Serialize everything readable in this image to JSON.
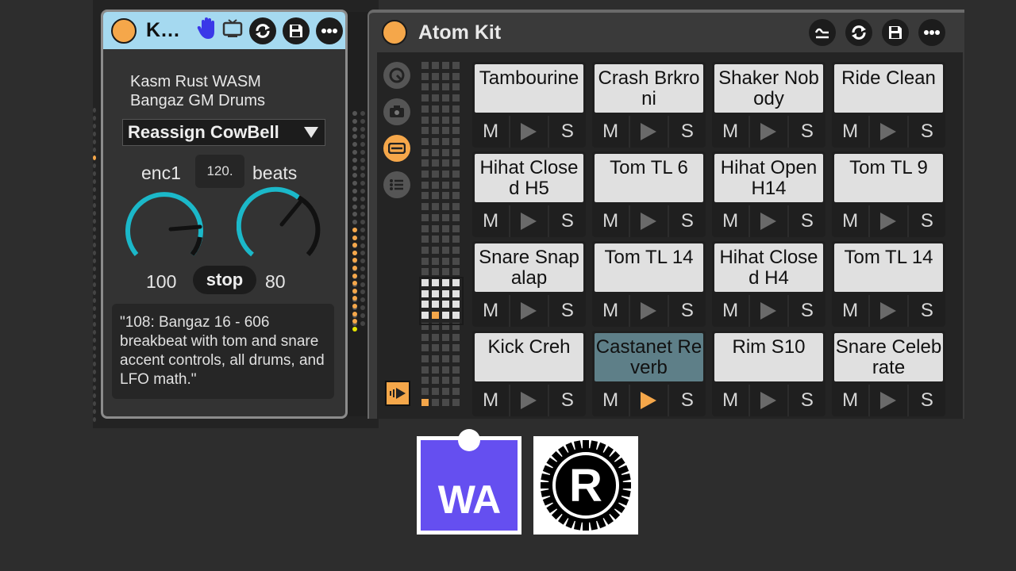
{
  "left_device": {
    "title": "K…",
    "lines": [
      "Kasm Rust WASM",
      "Bangaz GM Drums"
    ],
    "preset_select": "Reassign CowBell",
    "knob_left_label": "enc1",
    "tempo": "120.",
    "knob_right_label": "beats",
    "knob_left_value": "100",
    "knob_right_value": "80",
    "stop_label": "stop",
    "description": "\"108: Bangaz 16 - 606 breakbeat with tom and snare accent controls, all drums, and LFO math.\"",
    "icons": [
      "hand-icon",
      "tv-icon",
      "refresh-icon",
      "save-icon",
      "more-icon"
    ],
    "accent_color": "#a5d9f0",
    "knob_color": "#1bb8c9"
  },
  "right_device": {
    "title": "Atom Kit",
    "icons": [
      "wave-icon",
      "refresh-icon",
      "save-icon",
      "more-icon"
    ],
    "side_icons": [
      "circle-icon",
      "camera-icon",
      "pad-view-icon",
      "list-icon"
    ],
    "mute_label": "M",
    "solo_label": "S",
    "pads": [
      {
        "label": "Tambourine",
        "active": false,
        "playing": false
      },
      {
        "label": "Crash Brkroni",
        "active": false,
        "playing": false
      },
      {
        "label": "Shaker Nobody",
        "active": false,
        "playing": false
      },
      {
        "label": "Ride Clean",
        "active": false,
        "playing": false
      },
      {
        "label": "Hihat Closed H5",
        "active": false,
        "playing": false
      },
      {
        "label": "Tom TL 6",
        "active": false,
        "playing": false
      },
      {
        "label": "Hihat Open H14",
        "active": false,
        "playing": false
      },
      {
        "label": "Tom TL 9",
        "active": false,
        "playing": false
      },
      {
        "label": "Snare Snapalap",
        "active": false,
        "playing": false
      },
      {
        "label": "Tom TL 14",
        "active": false,
        "playing": false
      },
      {
        "label": "Hihat Closed H4",
        "active": false,
        "playing": false
      },
      {
        "label": "Tom TL 14",
        "active": false,
        "playing": false
      },
      {
        "label": "Kick Creh",
        "active": false,
        "playing": false
      },
      {
        "label": "Castanet Reverb",
        "active": true,
        "playing": true
      },
      {
        "label": "Rim S10",
        "active": false,
        "playing": false
      },
      {
        "label": "Snare Celebrate",
        "active": false,
        "playing": false
      }
    ],
    "accent_color": "#f5a74a"
  },
  "logos": {
    "webassembly": "WA",
    "rust": "R"
  }
}
